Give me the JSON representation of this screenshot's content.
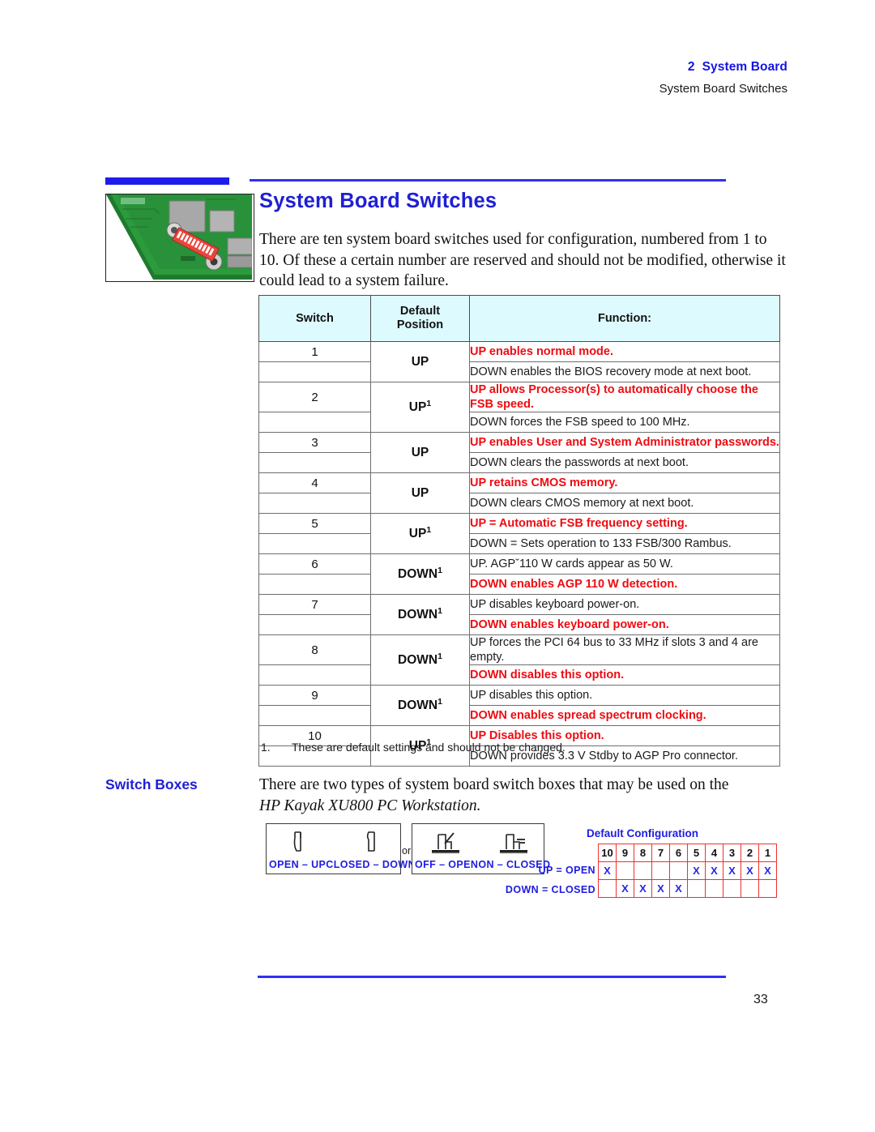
{
  "header": {
    "chapter_number": "2",
    "chapter_title": "System Board",
    "section_title": "System Board Switches"
  },
  "heading": "System Board Switches",
  "intro": "There are ten system board switches used for configuration, numbered from 1 to 10. Of these a certain number are reserved and should not be modified, otherwise it could lead to a system failure.",
  "table": {
    "columns": {
      "switch": "Switch",
      "default_position_line1": "Default",
      "default_position_line2": "Position",
      "function": "Function:"
    },
    "rows": [
      {
        "switch": "1",
        "position": "UP",
        "footnote_mark": "",
        "primary": "UP enables normal mode.",
        "primary_red": true,
        "secondary": "DOWN enables the BIOS recovery mode at next boot.",
        "secondary_red": false
      },
      {
        "switch": "2",
        "position": "UP",
        "footnote_mark": "1",
        "primary": "UP allows Processor(s) to automatically choose the FSB speed.",
        "primary_red": true,
        "secondary": "DOWN forces the FSB speed to 100 MHz.",
        "secondary_red": false
      },
      {
        "switch": "3",
        "position": "UP",
        "footnote_mark": "",
        "primary": "UP enables User and System Administrator passwords.",
        "primary_red": true,
        "secondary": "DOWN clears the passwords at next boot.",
        "secondary_red": false
      },
      {
        "switch": "4",
        "position": "UP",
        "footnote_mark": "",
        "primary": "UP retains CMOS memory.",
        "primary_red": true,
        "secondary": "DOWN clears CMOS memory at next boot.",
        "secondary_red": false
      },
      {
        "switch": "5",
        "position": "UP",
        "footnote_mark": "1",
        "primary": "UP = Automatic FSB frequency setting.",
        "primary_red": true,
        "secondary": "DOWN = Sets operation to 133 FSB/300 Rambus.",
        "secondary_red": false
      },
      {
        "switch": "6",
        "position": "DOWN",
        "footnote_mark": "1",
        "primary": "UP. AGPˇ110 W cards appear as 50 W.",
        "primary_red": false,
        "secondary": "DOWN enables AGP 110 W detection.",
        "secondary_red": true
      },
      {
        "switch": "7",
        "position": "DOWN",
        "footnote_mark": "1",
        "primary": "UP disables keyboard power-on.",
        "primary_red": false,
        "secondary": "DOWN enables keyboard power-on.",
        "secondary_red": true
      },
      {
        "switch": "8",
        "position": "DOWN",
        "footnote_mark": "1",
        "primary": "UP forces the PCI 64 bus to 33 MHz if slots 3 and 4 are empty.",
        "primary_red": false,
        "secondary": "DOWN disables this option.",
        "secondary_red": true
      },
      {
        "switch": "9",
        "position": "DOWN",
        "footnote_mark": "1",
        "primary": "UP disables this option.",
        "primary_red": false,
        "secondary": "DOWN enables spread spectrum clocking.",
        "secondary_red": true
      },
      {
        "switch": "10",
        "position": "UP",
        "footnote_mark": "1",
        "primary": "UP Disables this option.",
        "primary_red": true,
        "secondary": "DOWN provides 3.3 V Stdby to AGP Pro connector.",
        "secondary_red": false
      }
    ]
  },
  "footnote": {
    "mark": "1.",
    "text": "These are default settings and should not be changed."
  },
  "switch_boxes": {
    "side_heading": "Switch Boxes",
    "paragraph_line1": "There are two types of system board switch boxes that may be used on the",
    "paragraph_line2": "HP Kayak XU800 PC Workstation.",
    "or_label": "or",
    "box_a": {
      "left_label": "OPEN – UP",
      "right_label": "CLOSED – DOWN"
    },
    "box_b": {
      "left_label": "OFF – OPEN",
      "right_label": "ON – CLOSED"
    }
  },
  "default_configuration": {
    "title": "Default Configuration",
    "legend_up": "UP = OPEN",
    "legend_down": "DOWN = CLOSED",
    "switch_numbers": [
      "10",
      "9",
      "8",
      "7",
      "6",
      "5",
      "4",
      "3",
      "2",
      "1"
    ],
    "up_row": [
      "X",
      "",
      "",
      "",
      "",
      "X",
      "X",
      "X",
      "X",
      "X"
    ],
    "down_row": [
      "",
      "X",
      "X",
      "X",
      "X",
      "",
      "",
      "",
      "",
      ""
    ],
    "mark": "X"
  },
  "footer": {
    "page_number": "33"
  },
  "colors": {
    "brand_blue": "#1f1fd4",
    "accent_red": "#ee0b11",
    "table_header_bg": "#ddfbff",
    "grid_red": "#f03030"
  }
}
